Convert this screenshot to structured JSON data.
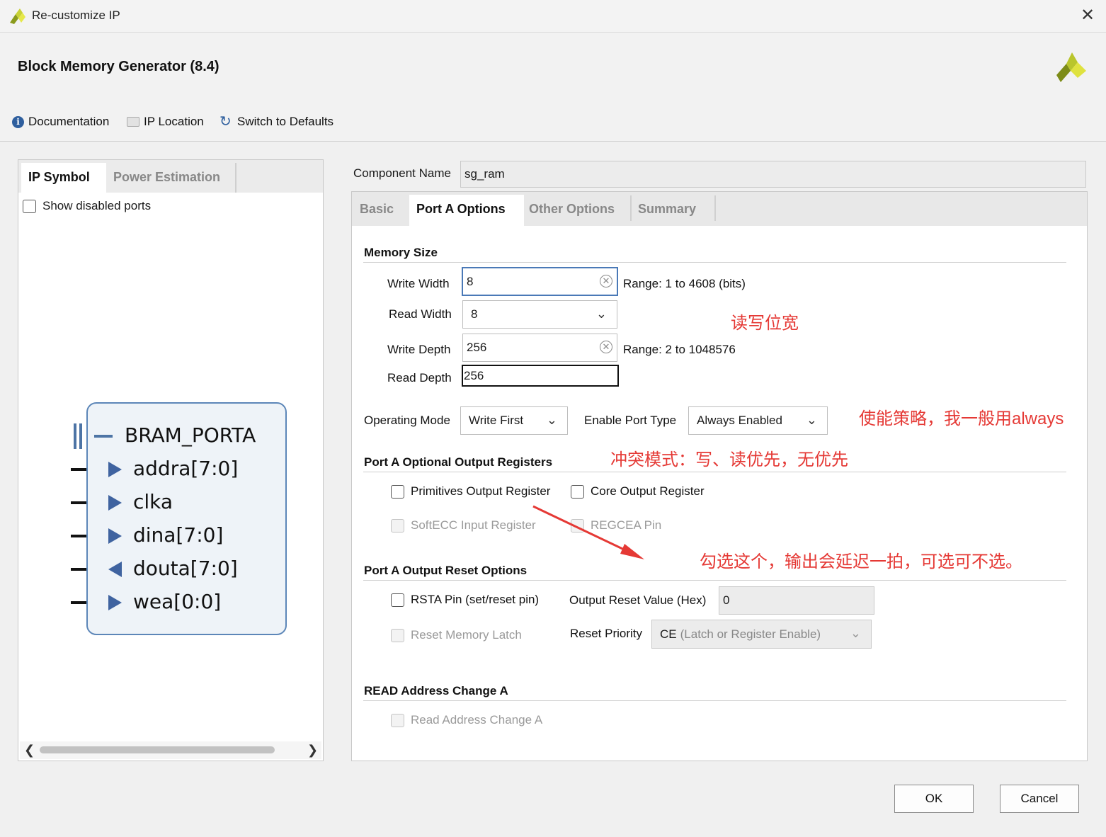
{
  "window": {
    "title": "Re-customize IP",
    "close_glyph": "✕"
  },
  "header": {
    "title": "Block Memory Generator (8.4)"
  },
  "toolbar": {
    "documentation": "Documentation",
    "ip_location": "IP Location",
    "switch_defaults": "Switch to Defaults"
  },
  "left_panel": {
    "tabs": [
      "IP Symbol",
      "Power Estimation"
    ],
    "show_disabled": "Show disabled ports",
    "symbol": {
      "bus_name": "BRAM_PORTA",
      "ports": [
        {
          "name": "addra[7:0]",
          "dir": "in"
        },
        {
          "name": "clka",
          "dir": "in"
        },
        {
          "name": "dina[7:0]",
          "dir": "in"
        },
        {
          "name": "douta[7:0]",
          "dir": "out"
        },
        {
          "name": "wea[0:0]",
          "dir": "in"
        }
      ]
    }
  },
  "component": {
    "label": "Component Name",
    "value": "sg_ram"
  },
  "tabs": [
    "Basic",
    "Port A Options",
    "Other Options",
    "Summary"
  ],
  "memory_size": {
    "title": "Memory Size",
    "write_width_label": "Write Width",
    "write_width": "8",
    "write_width_range": "Range: 1 to 4608 (bits)",
    "read_width_label": "Read Width",
    "read_width": "8",
    "write_depth_label": "Write Depth",
    "write_depth": "256",
    "write_depth_range": "Range: 2 to 1048576",
    "read_depth_label": "Read Depth",
    "read_depth": "256"
  },
  "operating": {
    "mode_label": "Operating Mode",
    "mode": "Write First",
    "enable_label": "Enable Port Type",
    "enable": "Always Enabled"
  },
  "optional_regs": {
    "title": "Port A Optional Output Registers",
    "primitives": "Primitives Output Register",
    "core": "Core Output Register",
    "softecc": "SoftECC Input Register",
    "regcea": "REGCEA Pin"
  },
  "reset": {
    "title": "Port A Output Reset Options",
    "rsta": "RSTA Pin (set/reset pin)",
    "value_label": "Output Reset Value (Hex)",
    "value": "0",
    "latch": "Reset Memory Latch",
    "priority_label": "Reset Priority",
    "priority_ce": "CE",
    "priority_rest": "(Latch or Register Enable)"
  },
  "read_addr": {
    "title": "READ Address Change A",
    "option": "Read Address Change A"
  },
  "annotations": {
    "width": "读写位宽",
    "enable": "使能策略，我一般用always",
    "conflict": "冲突模式：写、读优先，无优先",
    "register": "勾选这个，输出会延迟一拍，可选可不选。"
  },
  "buttons": {
    "ok": "OK",
    "cancel": "Cancel"
  },
  "icons": {
    "scroll_left": "❮",
    "scroll_right": "❯",
    "chevron": "⌄",
    "clear": "✕",
    "refresh": "↻",
    "info": "i"
  }
}
